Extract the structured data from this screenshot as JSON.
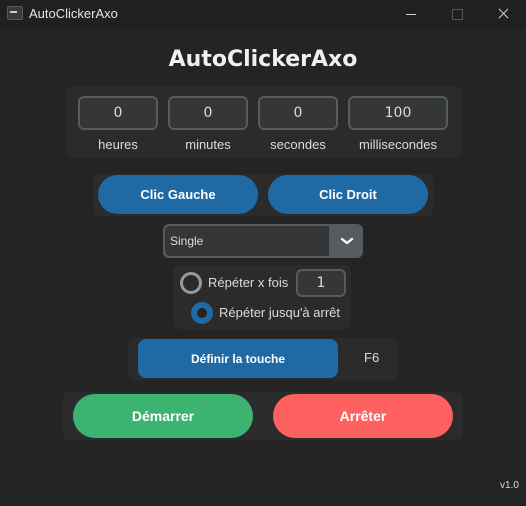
{
  "window": {
    "title": "AutoClickerAxo"
  },
  "app": {
    "heading": "AutoClickerAxo",
    "version": "v1.0"
  },
  "interval": {
    "fields": [
      {
        "value": "0",
        "label": "heures"
      },
      {
        "value": "0",
        "label": "minutes"
      },
      {
        "value": "0",
        "label": "secondes"
      },
      {
        "value": "100",
        "label": "millisecondes"
      }
    ]
  },
  "click_type": {
    "left_label": "Clic Gauche",
    "right_label": "Clic Droit"
  },
  "mode_select": {
    "selected": "Single"
  },
  "repeat": {
    "times_label": "Répéter x fois",
    "times_value": "1",
    "until_stop_label": "Répéter jusqu'à arrêt",
    "selected_option": "until_stop"
  },
  "hotkey": {
    "button_label": "Définir la touche",
    "key": "F6"
  },
  "actions": {
    "start_label": "Démarrer",
    "stop_label": "Arrêter"
  },
  "colors": {
    "accent_blue": "#1f6aa5",
    "start_green": "#3cb371",
    "stop_red": "#ff6060",
    "background": "#242424"
  }
}
